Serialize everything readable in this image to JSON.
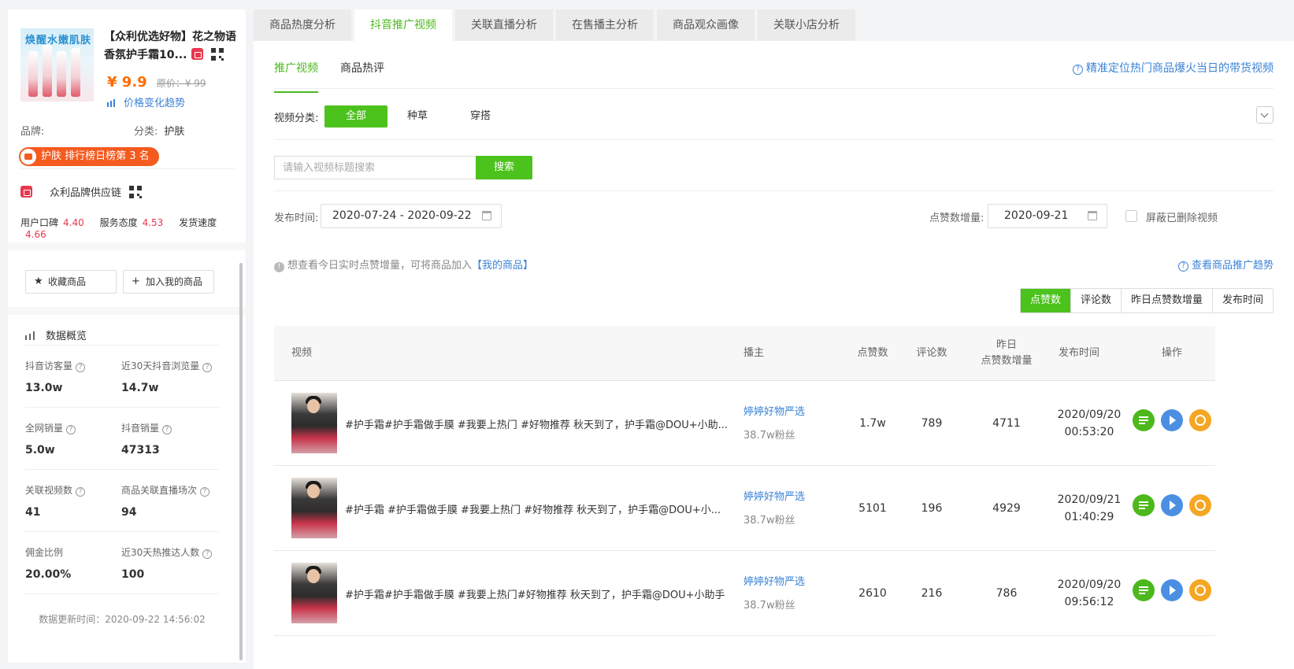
{
  "product": {
    "image_text": "焕醒水嫩肌肤",
    "title_line1": "【众利优选好物】花之物语",
    "title_line2": "香氛护手霜10...",
    "price": "¥ 9.9",
    "original_price": "原价：¥ 99",
    "trend_link": "价格变化趋势",
    "brand_label": "品牌:",
    "brand_value": "",
    "category_label": "分类:",
    "category_value": "护肤",
    "rank_badge": "护肤 排行榜日榜第 3 名"
  },
  "store": {
    "name": "众利品牌供应链",
    "scores": [
      {
        "label": "用户口碑",
        "value": "4.40"
      },
      {
        "label": "服务态度",
        "value": "4.53"
      },
      {
        "label": "发货速度",
        "value": "4.66"
      }
    ]
  },
  "actions": {
    "favorite": "收藏商品",
    "add_mine": "加入我的商品"
  },
  "overview": {
    "title": "数据概览",
    "stats": [
      {
        "label": "抖音访客量",
        "value": "13.0w"
      },
      {
        "label": "近30天抖音浏览量",
        "value": "14.7w"
      },
      {
        "label": "全网销量",
        "value": "5.0w"
      },
      {
        "label": "抖音销量",
        "value": "47313"
      },
      {
        "label": "关联视频数",
        "value": "41"
      },
      {
        "label": "商品关联直播场次",
        "value": "94"
      },
      {
        "label": "佣金比例",
        "value": "20.00%"
      },
      {
        "label": "近30天热推达人数",
        "value": "100"
      }
    ],
    "update_time": "数据更新时间：2020-09-22 14:56:02"
  },
  "tabs": [
    "商品热度分析",
    "抖音推广视频",
    "关联直播分析",
    "在售播主分析",
    "商品观众画像",
    "关联小店分析"
  ],
  "subtabs": [
    "推广视频",
    "商品热评"
  ],
  "help_link": "精准定位热门商品爆火当日的带货视频",
  "filters": {
    "category_label": "视频分类:",
    "categories": [
      "全部",
      "种草",
      "穿搭"
    ],
    "search_placeholder": "请输入视频标题搜索",
    "search_button": "搜索",
    "publish_label": "发布时间:",
    "publish_range": "2020-07-24 - 2020-09-22",
    "likes_label": "点赞数增量:",
    "likes_date": "2020-09-21",
    "hide_deleted": "屏蔽已删除视频"
  },
  "info": {
    "text": "想查看今日实时点赞增量，可将商品加入",
    "link": "【我的商品】",
    "trend_link": "查看商品推广趋势"
  },
  "sort_buttons": [
    "点赞数",
    "评论数",
    "昨日点赞数增量",
    "发布时间"
  ],
  "table": {
    "headers": {
      "video": "视频",
      "anchor": "播主",
      "likes": "点赞数",
      "comments": "评论数",
      "yesterday_line1": "昨日",
      "yesterday_line2": "点赞数增量",
      "publish": "发布时间",
      "ops": "操作"
    },
    "rows": [
      {
        "title": "#护手霜#护手霜做手膜 #我要上热门 #好物推荐 秋天到了，护手霜@DOU+小助...",
        "anchor": "婷婷好物严选",
        "fans": "38.7w粉丝",
        "likes": "1.7w",
        "comments": "789",
        "yesterday": "4711",
        "date": "2020/09/20",
        "time": "00:53:20"
      },
      {
        "title": "#护手霜 #护手霜做手膜 #我要上热门 #好物推荐 秋天到了，护手霜@DOU+小...",
        "anchor": "婷婷好物严选",
        "fans": "38.7w粉丝",
        "likes": "5101",
        "comments": "196",
        "yesterday": "4929",
        "date": "2020/09/21",
        "time": "01:40:29"
      },
      {
        "title": "#护手霜#护手霜做手膜 #我要上热门#好物推荐 秋天到了，护手霜@DOU+小助手",
        "anchor": "婷婷好物严选",
        "fans": "38.7w粉丝",
        "likes": "2610",
        "comments": "216",
        "yesterday": "786",
        "date": "2020/09/20",
        "time": "09:56:12"
      }
    ]
  }
}
